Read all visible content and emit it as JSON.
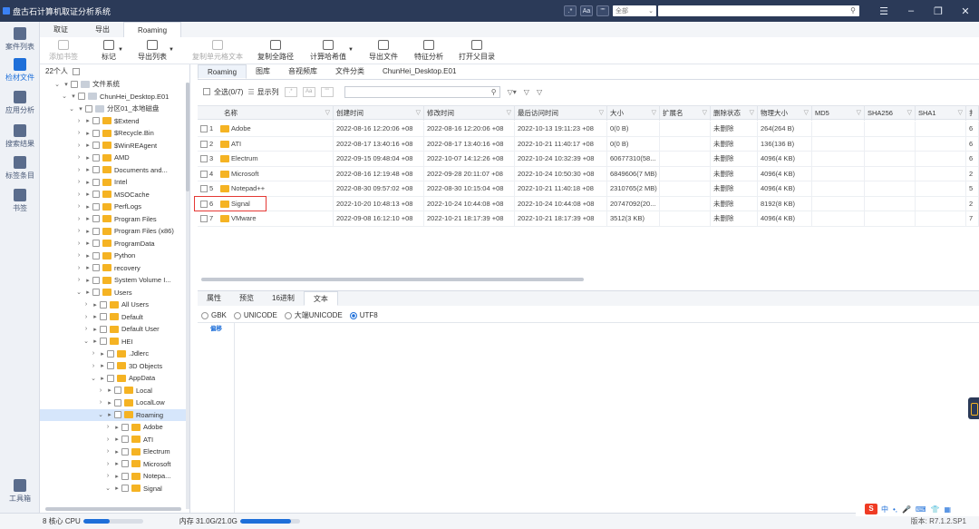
{
  "titlebar": {
    "title": "盘古石计算机取证分析系统",
    "btn_a": ".*",
    "btn_b": "Aa",
    "btn_c": "\"\"",
    "search_scope": "全部",
    "search_value": ""
  },
  "rail": {
    "items": [
      "案件列表",
      "检材文件",
      "应用分析",
      "搜索结果",
      "标签条目",
      "书签"
    ],
    "bottom": "工具箱"
  },
  "menu_tabs": [
    "取证",
    "导出",
    "Roaming"
  ],
  "toolbar": {
    "add_bookmark": "添加书签",
    "mark": "标记",
    "export_list": "导出列表",
    "copy_cell_text": "复制单元格文本",
    "copy_full_path": "复制全路径",
    "calc_hash": "计算哈希值",
    "export_file": "导出文件",
    "feature_analysis": "特征分析",
    "open_parent": "打开父目录"
  },
  "left_panel": {
    "header": "22个人",
    "tree": [
      {
        "label": "文件系统",
        "depth": 0,
        "type": "drive"
      },
      {
        "label": "ChunHei_Desktop.E01",
        "depth": 1,
        "type": "drive"
      },
      {
        "label": "分区01_本地磁盘",
        "depth": 2,
        "type": "drive"
      },
      {
        "label": "$Extend",
        "depth": 3,
        "type": "folder"
      },
      {
        "label": "$Recycle.Bin",
        "depth": 3,
        "type": "folder"
      },
      {
        "label": "$WinREAgent",
        "depth": 3,
        "type": "folder"
      },
      {
        "label": "AMD",
        "depth": 3,
        "type": "folder"
      },
      {
        "label": "Documents and...",
        "depth": 3,
        "type": "folder"
      },
      {
        "label": "Intel",
        "depth": 3,
        "type": "folder"
      },
      {
        "label": "MSOCache",
        "depth": 3,
        "type": "folder"
      },
      {
        "label": "PerfLogs",
        "depth": 3,
        "type": "folder"
      },
      {
        "label": "Program Files",
        "depth": 3,
        "type": "folder"
      },
      {
        "label": "Program Files (x86)",
        "depth": 3,
        "type": "folder"
      },
      {
        "label": "ProgramData",
        "depth": 3,
        "type": "folder"
      },
      {
        "label": "Python",
        "depth": 3,
        "type": "folder"
      },
      {
        "label": "recovery",
        "depth": 3,
        "type": "folder"
      },
      {
        "label": "System Volume I...",
        "depth": 3,
        "type": "folder"
      },
      {
        "label": "Users",
        "depth": 3,
        "type": "folder"
      },
      {
        "label": "All Users",
        "depth": 4,
        "type": "folder"
      },
      {
        "label": "Default",
        "depth": 4,
        "type": "folder"
      },
      {
        "label": "Default User",
        "depth": 4,
        "type": "folder"
      },
      {
        "label": "HEI",
        "depth": 4,
        "type": "folder"
      },
      {
        "label": ".Jdlerc",
        "depth": 5,
        "type": "folder"
      },
      {
        "label": "3D Objects",
        "depth": 5,
        "type": "folder"
      },
      {
        "label": "AppData",
        "depth": 5,
        "type": "folder"
      },
      {
        "label": "Local",
        "depth": 6,
        "type": "folder"
      },
      {
        "label": "LocalLow",
        "depth": 6,
        "type": "folder"
      },
      {
        "label": "Roaming",
        "depth": 6,
        "type": "folder"
      },
      {
        "label": "Adobe",
        "depth": 7,
        "type": "folder"
      },
      {
        "label": "ATI",
        "depth": 7,
        "type": "folder"
      },
      {
        "label": "Electrum",
        "depth": 7,
        "type": "folder"
      },
      {
        "label": "Microsoft",
        "depth": 7,
        "type": "folder"
      },
      {
        "label": "Notepa...",
        "depth": 7,
        "type": "folder"
      },
      {
        "label": "Signal",
        "depth": 7,
        "type": "folder"
      }
    ]
  },
  "right_tabs": [
    "Roaming",
    "图库",
    "音视频库",
    "文件分类",
    "ChunHei_Desktop.E01"
  ],
  "filter_bar": {
    "select_all": "全选(0/7)",
    "show_columns": "显示列",
    "btn_a": ".*",
    "btn_b": "Aa",
    "btn_c": "\"\"",
    "search_value": ""
  },
  "table": {
    "columns": [
      "名称",
      "创建时间",
      "修改时间",
      "最后访问时间",
      "大小",
      "扩展名",
      "删除状态",
      "物理大小",
      "MD5",
      "SHA256",
      "SHA1",
      "扌"
    ],
    "rows": [
      {
        "n": "1",
        "name": "Adobe",
        "created": "2022-08-16 12:20:06 +08",
        "modified": "2022-08-16 12:20:06 +08",
        "accessed": "2022-10-13 19:11:23 +08",
        "size": "0(0 B)",
        "ext": "",
        "del": "未删除",
        "phys": "264(264 B)",
        "md5": "",
        "sha256": "",
        "sha1": "",
        "x": "6"
      },
      {
        "n": "2",
        "name": "ATI",
        "created": "2022-08-17 13:40:16 +08",
        "modified": "2022-08-17 13:40:16 +08",
        "accessed": "2022-10-21 11:40:17 +08",
        "size": "0(0 B)",
        "ext": "",
        "del": "未删除",
        "phys": "136(136 B)",
        "md5": "",
        "sha256": "",
        "sha1": "",
        "x": "6"
      },
      {
        "n": "3",
        "name": "Electrum",
        "created": "2022-09-15 09:48:04 +08",
        "modified": "2022-10-07 14:12:26 +08",
        "accessed": "2022-10-24 10:32:39 +08",
        "size": "60677310(58...",
        "ext": "",
        "del": "未删除",
        "phys": "4096(4 KB)",
        "md5": "",
        "sha256": "",
        "sha1": "",
        "x": "6"
      },
      {
        "n": "4",
        "name": "Microsoft",
        "created": "2022-08-16 12:19:48 +08",
        "modified": "2022-09-28 20:11:07 +08",
        "accessed": "2022-10-24 10:50:30 +08",
        "size": "6849606(7 MB)",
        "ext": "",
        "del": "未删除",
        "phys": "4096(4 KB)",
        "md5": "",
        "sha256": "",
        "sha1": "",
        "x": "2"
      },
      {
        "n": "5",
        "name": "Notepad++",
        "created": "2022-08-30 09:57:02 +08",
        "modified": "2022-08-30 10:15:04 +08",
        "accessed": "2022-10-21 11:40:18 +08",
        "size": "2310765(2 MB)",
        "ext": "",
        "del": "未删除",
        "phys": "4096(4 KB)",
        "md5": "",
        "sha256": "",
        "sha1": "",
        "x": "5"
      },
      {
        "n": "6",
        "name": "Signal",
        "created": "2022-10-20 10:48:13 +08",
        "modified": "2022-10-24 10:44:08 +08",
        "accessed": "2022-10-24 10:44:08 +08",
        "size": "20747092(20...",
        "ext": "",
        "del": "未删除",
        "phys": "8192(8 KB)",
        "md5": "",
        "sha256": "",
        "sha1": "",
        "x": "2"
      },
      {
        "n": "7",
        "name": "VMware",
        "created": "2022-09-08 16:12:10 +08",
        "modified": "2022-10-21 18:17:39 +08",
        "accessed": "2022-10-21 18:17:39 +08",
        "size": "3512(3 KB)",
        "ext": "",
        "del": "未删除",
        "phys": "4096(4 KB)",
        "md5": "",
        "sha256": "",
        "sha1": "",
        "x": "7"
      }
    ]
  },
  "bottom_tabs": [
    "属性",
    "预览",
    "16进制",
    "文本"
  ],
  "encodings": [
    "GBK",
    "UNICODE",
    "大端UNICODE",
    "UTF8"
  ],
  "hex_offset_label": "偏移",
  "status": {
    "cpu_label": "8 核心 CPU",
    "mem_label": "内存 31.0G/21.0G",
    "version": "版本: R7.1.2.SP1"
  },
  "ime": {
    "logo": "S",
    "lang": "中"
  },
  "colors": {
    "accent": "#1e6fd9",
    "titlebar": "#2b3a58",
    "folder": "#f5b323",
    "highlight": "#e53935"
  }
}
